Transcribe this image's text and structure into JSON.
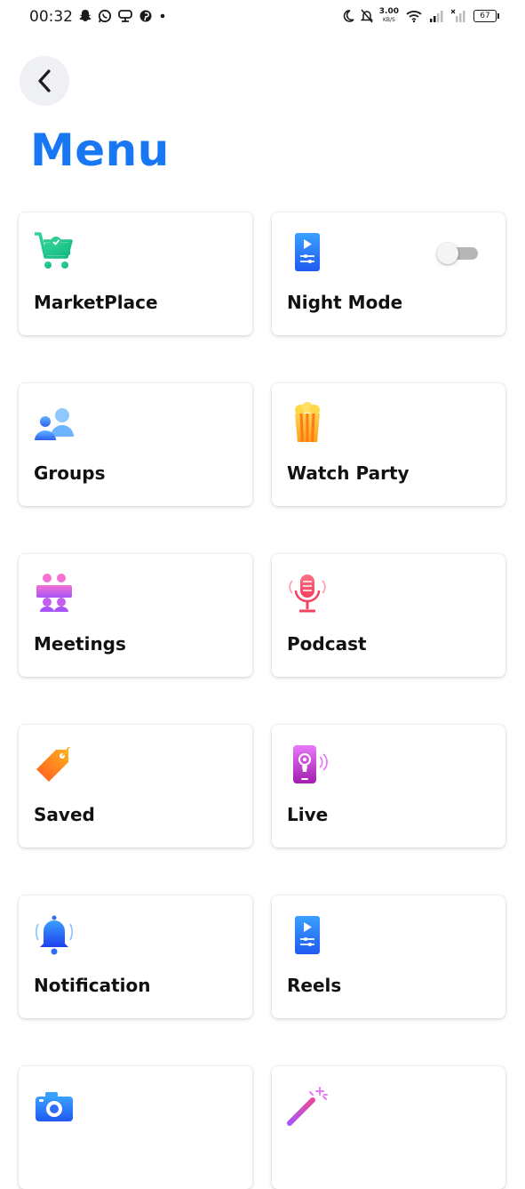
{
  "status_bar": {
    "time": "00:32",
    "speed_value": "3.00",
    "speed_unit": "KB/S",
    "battery": "67"
  },
  "header": {
    "back_icon": "chevron-left-icon",
    "title": "Menu"
  },
  "colors": {
    "title": "#1877f2",
    "back_bg": "#eef0f4",
    "toggle_off": "#b7b7b7"
  },
  "menu": {
    "items": [
      {
        "label": "MarketPlace",
        "icon": "shopping-cart-icon"
      },
      {
        "label": "Night Mode",
        "icon": "phone-play-icon",
        "toggle": "off"
      },
      {
        "label": "Groups",
        "icon": "people-icon"
      },
      {
        "label": "Watch Party",
        "icon": "popcorn-icon"
      },
      {
        "label": "Meetings",
        "icon": "meeting-icon"
      },
      {
        "label": "Podcast",
        "icon": "microphone-icon"
      },
      {
        "label": "Saved",
        "icon": "tag-icon"
      },
      {
        "label": "Live",
        "icon": "live-phone-icon"
      },
      {
        "label": "Notification",
        "icon": "bell-icon"
      },
      {
        "label": "Reels",
        "icon": "phone-play-icon"
      },
      {
        "label": "",
        "icon": "camera-icon"
      },
      {
        "label": "",
        "icon": "magic-wand-icon"
      }
    ]
  }
}
